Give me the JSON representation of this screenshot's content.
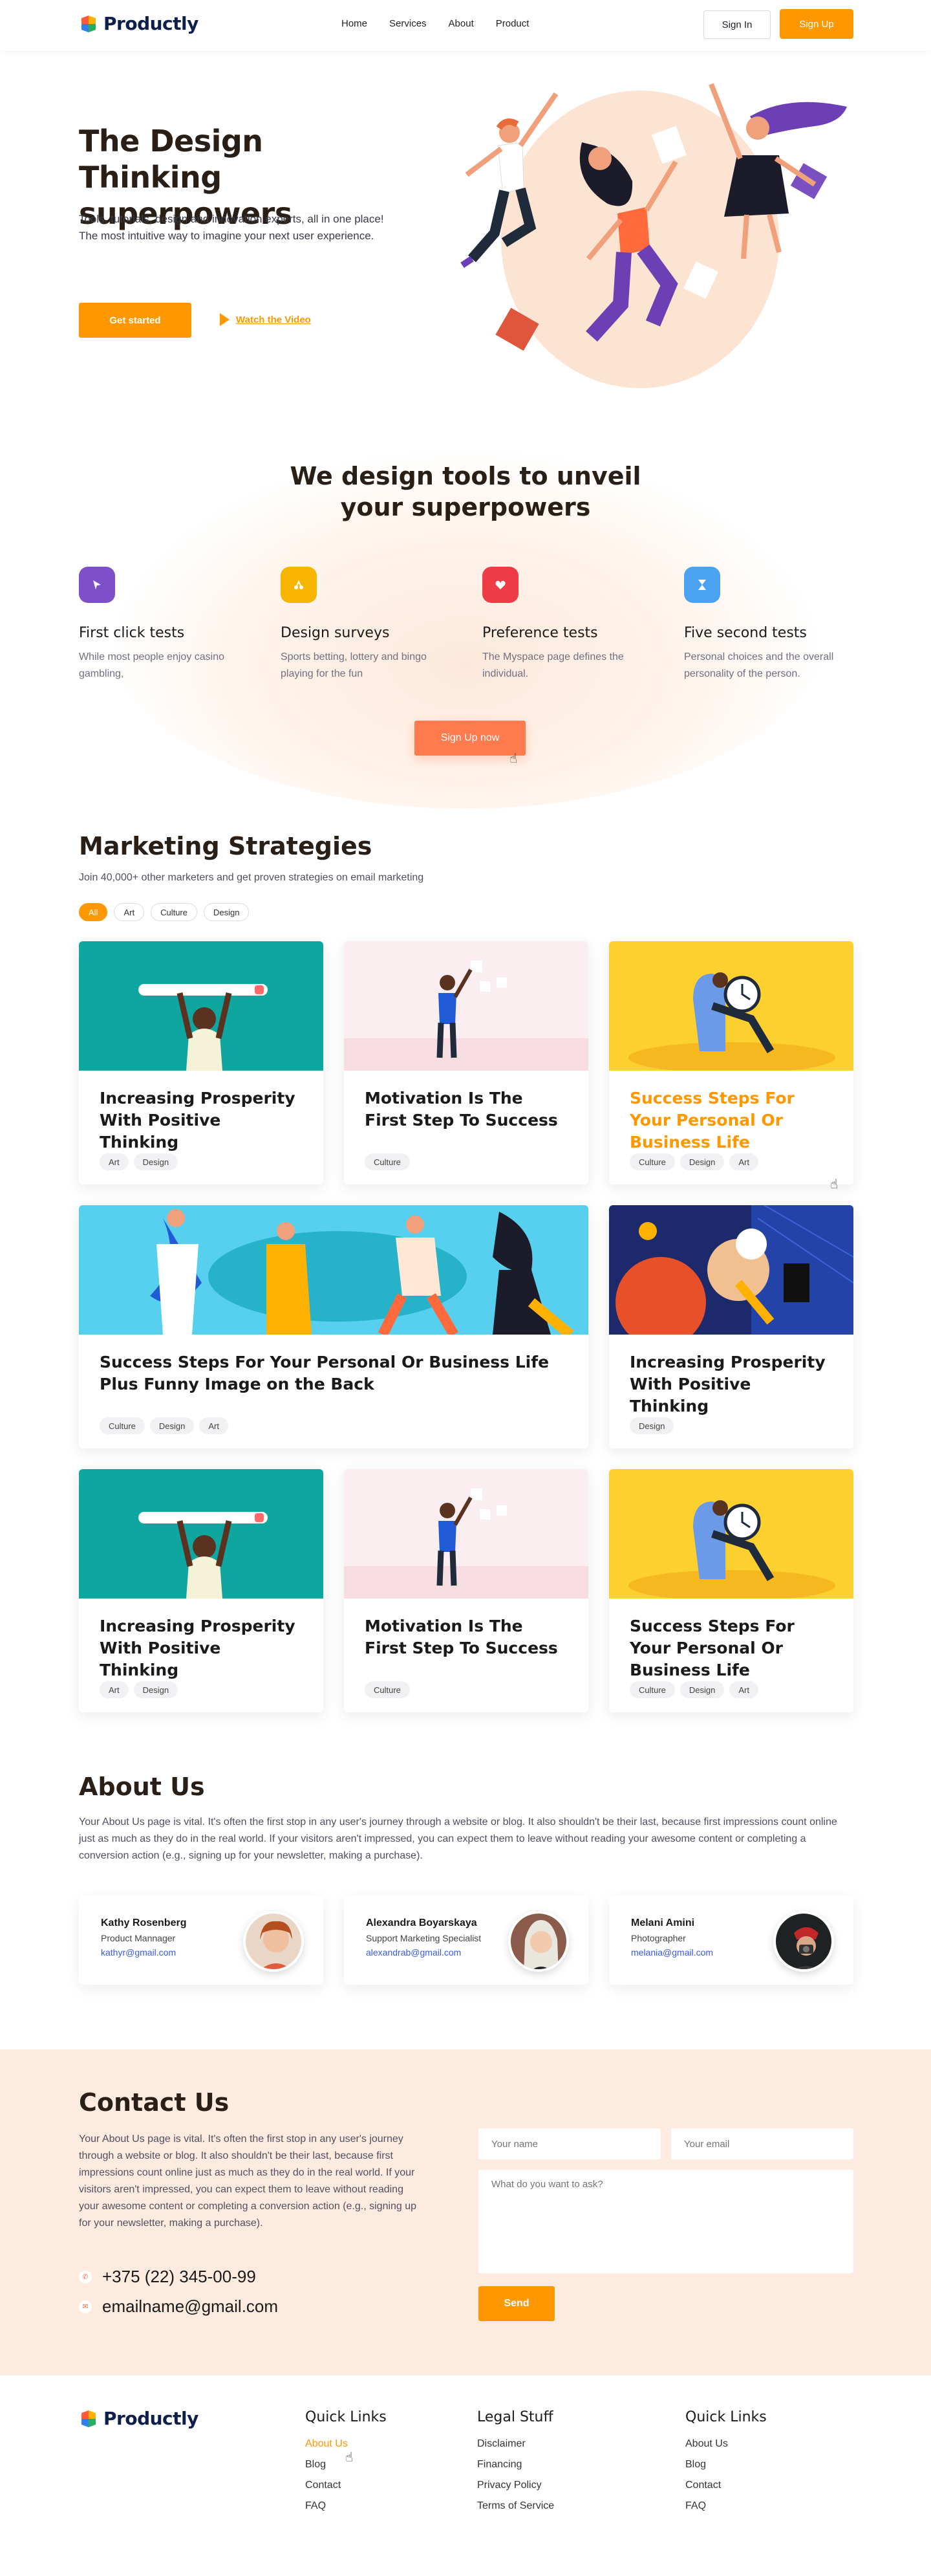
{
  "brand": {
    "name": "Productly",
    "accent": "#ff9800"
  },
  "header": {
    "nav": [
      "Home",
      "Services",
      "About",
      "Product"
    ],
    "signin_label": "Sign In",
    "signup_label": "Sign Up"
  },
  "hero": {
    "title": "The Design Thinking superpowers",
    "text": "Tools, tutorials, design and innovation experts, all in one place! The most intuitive way to imagine your next user experience.",
    "cta_label": "Get started",
    "video_label": "Watch the Video"
  },
  "tools": {
    "title": "We design tools to unveil your superpowers",
    "items": [
      {
        "name": "First click tests",
        "desc": "While most people enjoy casino gambling,",
        "color": "#7d4fc9",
        "icon": "cursor-icon"
      },
      {
        "name": "Design surveys",
        "desc": "Sports betting, lottery and bingo playing for the fun",
        "color": "#f7b500",
        "icon": "survey-icon"
      },
      {
        "name": "Preference tests",
        "desc": "The Myspace page defines the individual.",
        "color": "#ef3b45",
        "icon": "heart-icon"
      },
      {
        "name": "Five second tests",
        "desc": "Personal choices and the overall personality of the person.",
        "color": "#4aa3f0",
        "icon": "hourglass-icon"
      }
    ],
    "cta_label": "Sign Up now"
  },
  "marketing": {
    "title": "Marketing Strategies",
    "subtitle": "Join 40,000+ other marketers and get proven strategies on email marketing",
    "filters": [
      "All",
      "Art",
      "Culture",
      "Design"
    ],
    "cards": [
      {
        "title": "Increasing Prosperity With Positive Thinking",
        "tags": [
          "Art",
          "Design"
        ]
      },
      {
        "title": "Motivation Is The First Step To Success",
        "tags": [
          "Culture"
        ]
      },
      {
        "title": "Success Steps For Your Personal Or Business Life",
        "tags": [
          "Culture",
          "Design",
          "Art"
        ]
      },
      {
        "title": "Success Steps For Your Personal Or Business Life Plus Funny Image on the Back",
        "tags": [
          "Culture",
          "Design",
          "Art"
        ]
      },
      {
        "title": "Increasing Prosperity With Positive Thinking",
        "tags": [
          "Design"
        ]
      },
      {
        "title": "Increasing Prosperity With Positive Thinking",
        "tags": [
          "Art",
          "Design"
        ]
      },
      {
        "title": "Motivation Is The First Step To Success",
        "tags": [
          "Culture"
        ]
      },
      {
        "title": "Success Steps For Your Personal Or Business Life",
        "tags": [
          "Culture",
          "Design",
          "Art"
        ]
      }
    ]
  },
  "about": {
    "title": "About Us",
    "text": "Your About Us page is vital. It's often the first stop in any user's journey through a website or blog. It also shouldn't be their last, because first impressions count online just as much as they do in the real world. If your visitors aren't impressed, you can expect them to leave without reading your awesome content or completing a conversion action (e.g., signing up for your newsletter, making a purchase).",
    "people": [
      {
        "name": "Kathy Rosenberg",
        "role": "Product Mannager",
        "email": "kathyr@gmail.com"
      },
      {
        "name": "Alexandra Boyarskaya",
        "role": "Support Marketing Specialist",
        "email": "alexandrab@gmail.com"
      },
      {
        "name": "Melani Amini",
        "role": "Photographer",
        "email": "melania@gmail.com"
      }
    ]
  },
  "contact": {
    "title": "Contact Us",
    "text": "Your About Us page is vital. It's often the first stop in any user's journey through a website or blog. It also shouldn't be their last, because first impressions count online just as much as they do in the real world. If your visitors aren't impressed, you can expect them to leave without reading your awesome content or completing a conversion action (e.g., signing up for your newsletter, making a purchase).",
    "phone": "+375 (22) 345-00-99",
    "email": "emailname@gmail.com",
    "name_placeholder": "Your name",
    "email_placeholder": "Your email",
    "message_placeholder": "What do you want to ask?",
    "send_label": "Send"
  },
  "footer": {
    "columns": [
      {
        "title": "Quick Links",
        "links": [
          "About Us",
          "Blog",
          "Contact",
          "FAQ"
        ]
      },
      {
        "title": "Legal Stuff",
        "links": [
          "Disclaimer",
          "Financing",
          "Privacy Policy",
          "Terms of Service"
        ]
      },
      {
        "title": "Quick Links",
        "links": [
          "About Us",
          "Blog",
          "Contact",
          "FAQ"
        ]
      }
    ]
  }
}
